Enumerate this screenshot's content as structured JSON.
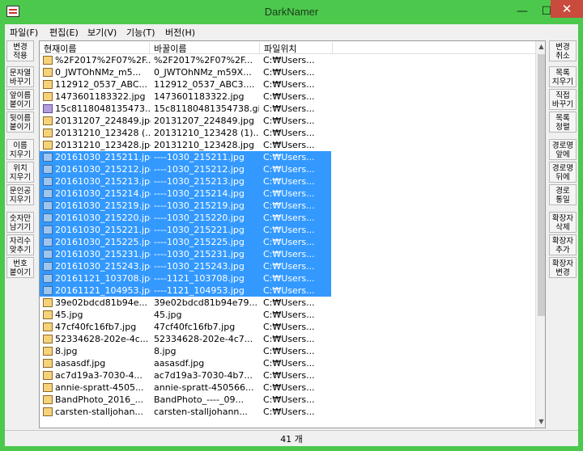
{
  "window": {
    "title": "DarkNamer"
  },
  "titlebar_buttons": {
    "minimize": "—",
    "maximize": "☐",
    "close": "✕"
  },
  "menu": [
    "파일(F)",
    "편집(E)",
    "보기(V)",
    "기능(T)",
    "버전(H)"
  ],
  "left_buttons": [
    "변경\n적용",
    "문자열\n바꾸기",
    "앞이름\n붙이기",
    "뒷이름\n붙이기",
    "이름\n지우기",
    "위치\n지우기",
    "문인공\n지우기",
    "숫자만\n남기기",
    "자리수\n맞추기",
    "번호\n붙이기"
  ],
  "right_buttons": [
    "변경\n취소",
    "목록\n지우기",
    "직접\n바꾸기",
    "목록\n정렬",
    "경로명\n앞에",
    "경로명\n뒤에",
    "경로\n통일",
    "확장자\n삭제",
    "확장자\n추가",
    "확장자\n변경"
  ],
  "columns": [
    "현재이름",
    "바꿀이름",
    "파일위치"
  ],
  "rows": [
    {
      "icon": "image-file-icon",
      "current": "%2F2017%2F07%2F...",
      "new": "%2F2017%2F07%2F...",
      "path": "C:₩Users...",
      "selected": false
    },
    {
      "icon": "image-file-icon",
      "current": "0_JWTOhNMz_m5...",
      "new": "0_JWTOhNMz_m59X...",
      "path": "C:₩Users...",
      "selected": false
    },
    {
      "icon": "image-file-icon",
      "current": "112912_0537_ABC...",
      "new": "112912_0537_ABC3....",
      "path": "C:₩Users...",
      "selected": false
    },
    {
      "icon": "image-file-icon",
      "current": "1473601183322.jpg",
      "new": "1473601183322.jpg",
      "path": "C:₩Users...",
      "selected": false
    },
    {
      "icon": "gif-file-icon",
      "current": "15c8118048135473...",
      "new": "15c81180481354738.gif",
      "path": "C:₩Users...",
      "selected": false
    },
    {
      "icon": "image-file-icon",
      "current": "20131207_224849.jpg",
      "new": "20131207_224849.jpg",
      "path": "C:₩Users...",
      "selected": false
    },
    {
      "icon": "image-file-icon",
      "current": "20131210_123428 (...",
      "new": "20131210_123428 (1)....",
      "path": "C:₩Users...",
      "selected": false
    },
    {
      "icon": "image-file-icon",
      "current": "20131210_123428.jpg",
      "new": "20131210_123428.jpg",
      "path": "C:₩Users...",
      "selected": false
    },
    {
      "icon": "image-file-icon",
      "current": "20161030_215211.jpg",
      "new": "----1030_215211.jpg",
      "path": "C:₩Users...",
      "selected": true
    },
    {
      "icon": "image-file-icon",
      "current": "20161030_215212.jpg",
      "new": "----1030_215212.jpg",
      "path": "C:₩Users...",
      "selected": true
    },
    {
      "icon": "image-file-icon",
      "current": "20161030_215213.jpg",
      "new": "----1030_215213.jpg",
      "path": "C:₩Users...",
      "selected": true
    },
    {
      "icon": "image-file-icon",
      "current": "20161030_215214.jpg",
      "new": "----1030_215214.jpg",
      "path": "C:₩Users...",
      "selected": true
    },
    {
      "icon": "image-file-icon",
      "current": "20161030_215219.jpg",
      "new": "----1030_215219.jpg",
      "path": "C:₩Users...",
      "selected": true
    },
    {
      "icon": "image-file-icon",
      "current": "20161030_215220.jpg",
      "new": "----1030_215220.jpg",
      "path": "C:₩Users...",
      "selected": true
    },
    {
      "icon": "image-file-icon",
      "current": "20161030_215221.jpg",
      "new": "----1030_215221.jpg",
      "path": "C:₩Users...",
      "selected": true
    },
    {
      "icon": "image-file-icon",
      "current": "20161030_215225.jpg",
      "new": "----1030_215225.jpg",
      "path": "C:₩Users...",
      "selected": true
    },
    {
      "icon": "image-file-icon",
      "current": "20161030_215231.jpg",
      "new": "----1030_215231.jpg",
      "path": "C:₩Users...",
      "selected": true
    },
    {
      "icon": "image-file-icon",
      "current": "20161030_215243.jpg",
      "new": "----1030_215243.jpg",
      "path": "C:₩Users...",
      "selected": true
    },
    {
      "icon": "image-file-icon",
      "current": "20161121_103708.jpg",
      "new": "----1121_103708.jpg",
      "path": "C:₩Users...",
      "selected": true
    },
    {
      "icon": "image-file-icon",
      "current": "20161121_104953.jpg",
      "new": "----1121_104953.jpg",
      "path": "C:₩Users...",
      "selected": true
    },
    {
      "icon": "image-file-icon",
      "current": "39e02bdcd81b94e...",
      "new": "39e02bdcd81b94e79...",
      "path": "C:₩Users...",
      "selected": false
    },
    {
      "icon": "image-file-icon",
      "current": "45.jpg",
      "new": "45.jpg",
      "path": "C:₩Users...",
      "selected": false
    },
    {
      "icon": "image-file-icon",
      "current": "47cf40fc16fb7.jpg",
      "new": "47cf40fc16fb7.jpg",
      "path": "C:₩Users...",
      "selected": false
    },
    {
      "icon": "image-file-icon",
      "current": "52334628-202e-4c...",
      "new": "52334628-202e-4c7...",
      "path": "C:₩Users...",
      "selected": false
    },
    {
      "icon": "image-file-icon",
      "current": "8.jpg",
      "new": "8.jpg",
      "path": "C:₩Users...",
      "selected": false
    },
    {
      "icon": "image-file-icon",
      "current": "aasasdf.jpg",
      "new": "aasasdf.jpg",
      "path": "C:₩Users...",
      "selected": false
    },
    {
      "icon": "image-file-icon",
      "current": "ac7d19a3-7030-4...",
      "new": "ac7d19a3-7030-4b7...",
      "path": "C:₩Users...",
      "selected": false
    },
    {
      "icon": "image-file-icon",
      "current": "annie-spratt-4505...",
      "new": "annie-spratt-450566...",
      "path": "C:₩Users...",
      "selected": false
    },
    {
      "icon": "image-file-icon",
      "current": "BandPhoto_2016_...",
      "new": "BandPhoto_----_09...",
      "path": "C:₩Users...",
      "selected": false
    },
    {
      "icon": "image-file-icon",
      "current": "carsten-stalljohan...",
      "new": "carsten-stalljohann...",
      "path": "C:₩Users...",
      "selected": false
    }
  ],
  "status": {
    "count_text": "41 개"
  },
  "colors": {
    "frame": "#4cc84c",
    "selection": "#3399ff",
    "close": "#c84b3e"
  }
}
